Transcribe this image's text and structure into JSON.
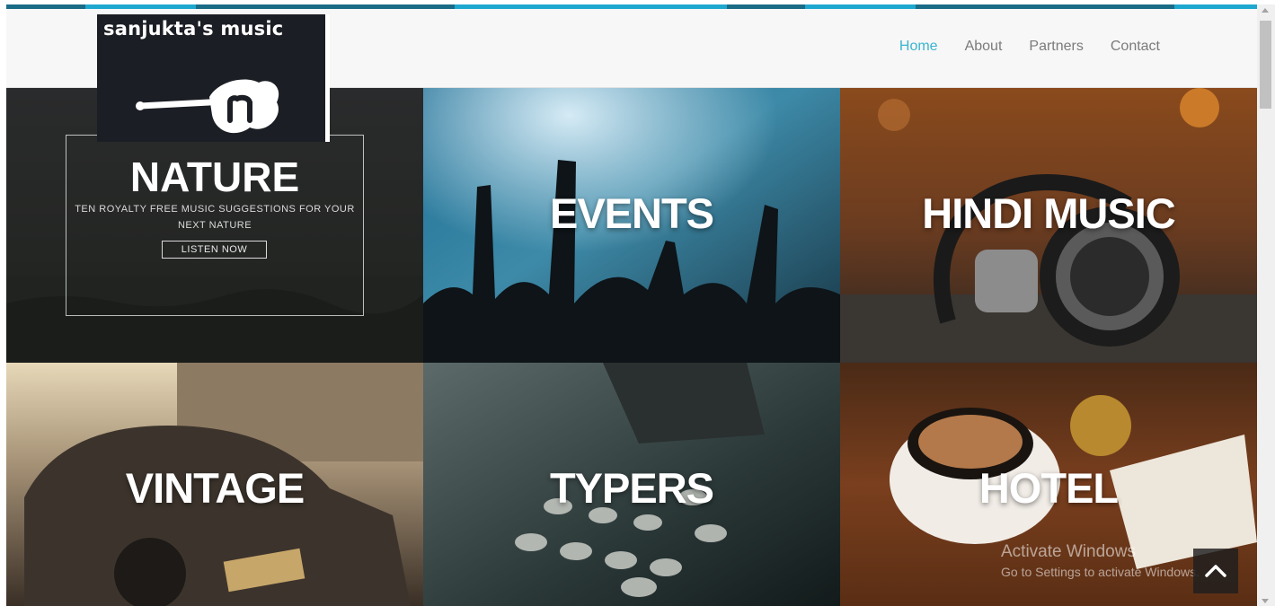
{
  "brand": {
    "name": "sanjukta's music",
    "logo_icon": "guitar-n-icon"
  },
  "nav": {
    "items": [
      {
        "label": "Home",
        "active": true
      },
      {
        "label": "About",
        "active": false
      },
      {
        "label": "Partners",
        "active": false
      },
      {
        "label": "Contact",
        "active": false
      }
    ]
  },
  "tiles": [
    {
      "title": "NATURE",
      "subtitle": "TEN ROYALTY FREE MUSIC SUGGESTIONS FOR YOUR NEXT NATURE",
      "button": "LISTEN NOW"
    },
    {
      "title": "EVENTS"
    },
    {
      "title": "HINDI MUSIC"
    },
    {
      "title": "VINTAGE"
    },
    {
      "title": "TYPERS"
    },
    {
      "title": "HOTEL"
    }
  ],
  "watermark": {
    "title": "Activate Windows",
    "subtitle": "Go to Settings to activate Windows."
  },
  "back_to_top": {
    "icon": "chevron-up-icon"
  },
  "colors": {
    "accent": "#3cb4cf",
    "nav_text": "#7b7b7b",
    "header_bg": "#f7f7f7",
    "logo_bg": "#1b1e24"
  }
}
